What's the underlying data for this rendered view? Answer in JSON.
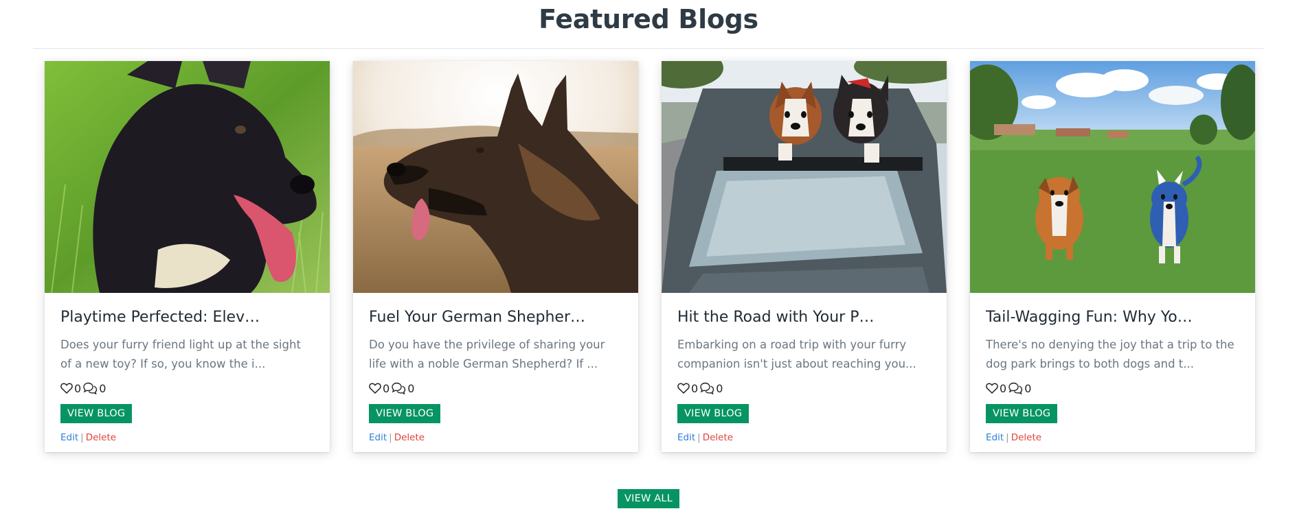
{
  "section": {
    "title": "Featured Blogs"
  },
  "cards": [
    {
      "title": "Playtime Perfected: Elev…",
      "excerpt": "Does your furry friend light up at the sight of a new toy? If so, you know the i...",
      "likes": "0",
      "comments": "0",
      "view_label": "VIEW BLOG",
      "edit_label": "Edit",
      "separator": "|",
      "delete_label": "Delete"
    },
    {
      "title": "Fuel Your German Shepher…",
      "excerpt": "Do you have the privilege of sharing your life with a noble German Shepherd? If ...",
      "likes": "0",
      "comments": "0",
      "view_label": "VIEW BLOG",
      "edit_label": "Edit",
      "separator": "|",
      "delete_label": "Delete"
    },
    {
      "title": "Hit the Road with Your P…",
      "excerpt": "Embarking on a road trip with your furry companion isn't just about reaching you...",
      "likes": "0",
      "comments": "0",
      "view_label": "VIEW BLOG",
      "edit_label": "Edit",
      "separator": "|",
      "delete_label": "Delete"
    },
    {
      "title": "Tail-Wagging Fun: Why Yo…",
      "excerpt": "There's no denying the joy that a trip to the dog park brings to both dogs and t...",
      "likes": "0",
      "comments": "0",
      "view_label": "VIEW BLOG",
      "edit_label": "Edit",
      "separator": "|",
      "delete_label": "Delete"
    }
  ],
  "footer": {
    "view_all_label": "VIEW ALL"
  },
  "icons": {
    "like": "heart-icon",
    "comment": "comments-icon"
  },
  "colors": {
    "button": "#079463",
    "edit_link": "#2f80d8",
    "delete_link": "#e0443a",
    "title": "#2f3b44"
  }
}
